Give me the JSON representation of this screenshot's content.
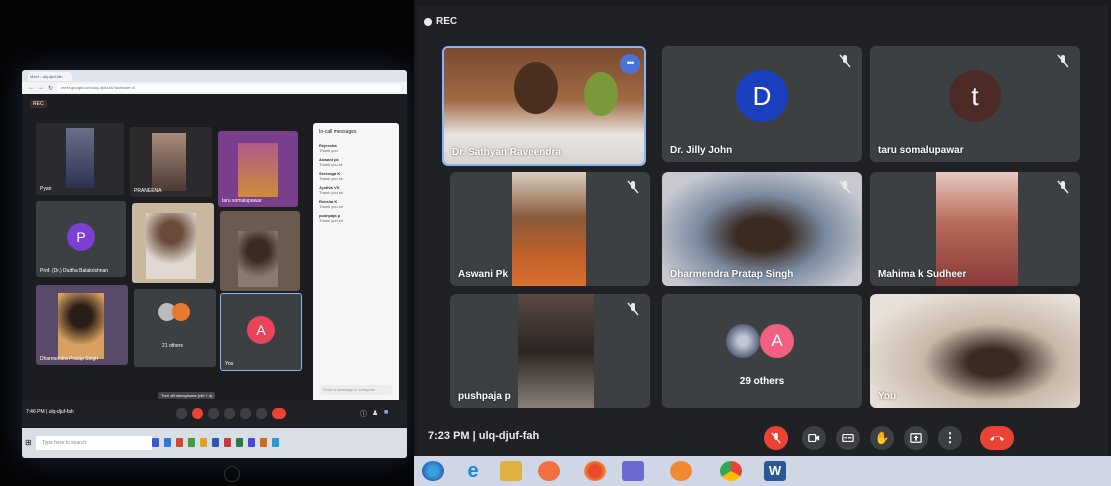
{
  "left_screen": {
    "browser": {
      "tab_label": "Meet - ulq-djuf-fah",
      "url": "meet.google.com/ulq-djuf-fah?authuser=0"
    },
    "rec_label": "REC",
    "tiles": [
      {
        "name": "Pyari"
      },
      {
        "name": "PRANEENA"
      },
      {
        "name": "taru somalupawar"
      },
      {
        "name": "Prof. (Dr.) Dudha Balakrishnan",
        "avatar_letter": "P",
        "avatar_color": "#7b3fd1"
      },
      {
        "name": ""
      },
      {
        "name": ""
      },
      {
        "name": "Dharmendra Pratap Singh"
      },
      {
        "name": "21 others"
      },
      {
        "name": "You",
        "avatar_letter": "A",
        "avatar_color": "#e8445a"
      }
    ],
    "chat": {
      "title": "In-call messages",
      "messages": [
        {
          "sender": "Rejeesha",
          "text": "Thank you"
        },
        {
          "sender": "Aswani pk",
          "text": "Thank you sir"
        },
        {
          "sender": "Sreeraga K",
          "text": "Thank you sir"
        },
        {
          "sender": "Jyothis VS",
          "text": "Thank you sir"
        },
        {
          "sender": "Reesha K",
          "text": "Thank you sir"
        },
        {
          "sender": "pushpaja p",
          "text": "Thank you sir"
        }
      ],
      "input_placeholder": "Send a message to everyone"
    },
    "meeting_info": "7:46 PM | ulq-djuf-fah",
    "tooltip": "Turn off microphone (ctrl + d)",
    "taskbar_search": "Type here to search"
  },
  "right_screen": {
    "rec_label": "REC",
    "tiles": [
      {
        "name": "Dr. Sathyan Raveendra",
        "kind": "video",
        "active": true
      },
      {
        "name": "Dr. Jilly John",
        "kind": "avatar",
        "avatar_letter": "D",
        "avatar_color": "#1a3fbf",
        "muted": true
      },
      {
        "name": "taru somalupawar",
        "kind": "avatar",
        "avatar_letter": "t",
        "avatar_color": "#4e2a26",
        "muted": true
      },
      {
        "name": "Aswani Pk",
        "kind": "video",
        "muted": true
      },
      {
        "name": "Dharmendra Pratap Singh",
        "kind": "video",
        "muted": true
      },
      {
        "name": "Mahima k Sudheer",
        "kind": "video",
        "muted": true
      },
      {
        "name": "pushpaja p",
        "kind": "video",
        "muted": true
      },
      {
        "name": "29 others",
        "kind": "others",
        "avatar_letter": "A",
        "avatar_color": "#f06080"
      },
      {
        "name": "You",
        "kind": "video"
      }
    ],
    "meeting_info": "7:23 PM | ulq-djuf-fah",
    "controls": [
      {
        "name": "microphone-off",
        "color": "#ea4335"
      },
      {
        "name": "camera"
      },
      {
        "name": "captions"
      },
      {
        "name": "raise-hand"
      },
      {
        "name": "present-now"
      },
      {
        "name": "more-options"
      },
      {
        "name": "leave-call",
        "color": "#ea4335"
      }
    ]
  }
}
